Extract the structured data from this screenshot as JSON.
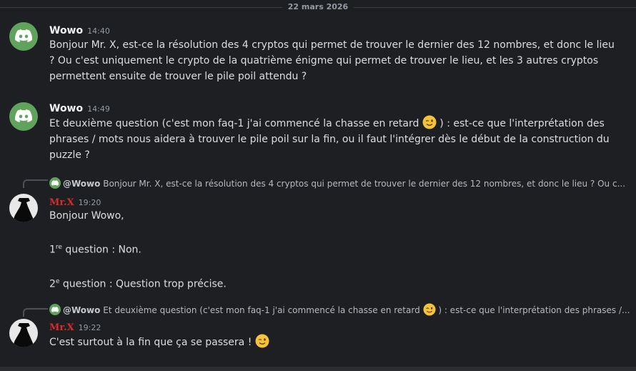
{
  "date_divider": "22 mars 2026",
  "messages": [
    {
      "author": "Wowo",
      "time": "14:40",
      "text": "Bonjour Mr. X, est-ce la résolution des 4 cryptos qui permet de trouver le dernier des 12 nombres, et  donc le lieu ? Ou c'est uniquement le crypto de la quatrième énigme qui permet de trouver le lieu, et les 3 autres cryptos permettent ensuite de trouver le pile poil attendu ?"
    },
    {
      "author": "Wowo",
      "time": "14:49",
      "text_before_emoji": "Et deuxième question (c'est mon faq-1 j'ai commencé la chasse en retard ",
      "emoji": "winking-face",
      "text_after_emoji": " ) : est-ce que l'interprétation des phrases / mots nous aidera à trouver le pile poil sur la fin, ou il faut l'intégrer dès le début de la construction du puzzle ?"
    },
    {
      "reply_to": {
        "author": "@Wowo",
        "preview": "Bonjour Mr. X, est-ce la résolution des 4 cryptos qui permet de trouver le dernier des 12 nombres, et  donc le lieu ?  Ou c..."
      },
      "author": "Mr.X",
      "time": "19:20",
      "greeting": "Bonjour Wowo,",
      "answer1_num": "1",
      "answer1_sup": "re",
      "answer1_text": " question : Non.",
      "answer2_num": "2",
      "answer2_sup": "e",
      "answer2_text": " question : Question trop précise."
    },
    {
      "reply_to": {
        "author": "@Wowo",
        "preview_before_emoji": "Et deuxième question (c'est mon faq-1 j'ai commencé la chasse en retard ",
        "preview_after_emoji": " ) : est-ce que l'interprétation des phrases /..."
      },
      "author": "Mr.X",
      "time": "19:22",
      "text": "C'est surtout à la fin que ça se passera ! "
    }
  ],
  "colors": {
    "background": "#1e1f22",
    "discord_avatar": "#5fa35c",
    "mrx_name": "#d82c2c"
  }
}
